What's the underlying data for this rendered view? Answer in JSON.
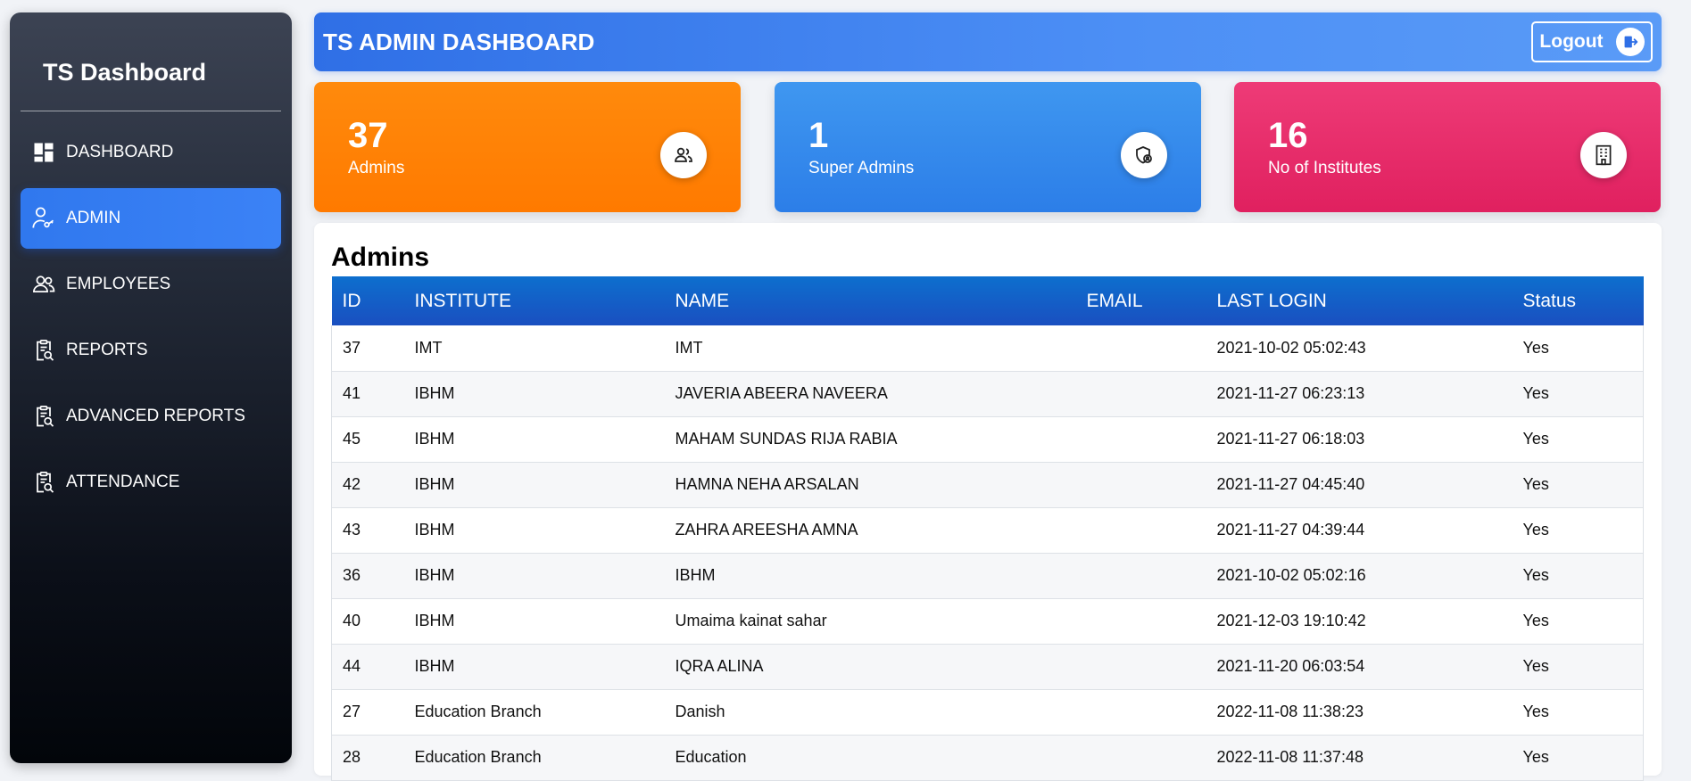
{
  "sidebar": {
    "brand": "TS Dashboard",
    "items": [
      {
        "label": "DASHBOARD",
        "icon": "dashboard-grid-icon",
        "active": false
      },
      {
        "label": "ADMIN",
        "icon": "user-key-icon",
        "active": true
      },
      {
        "label": "EMPLOYEES",
        "icon": "users-icon",
        "active": false
      },
      {
        "label": "REPORTS",
        "icon": "clipboard-search-icon",
        "active": false
      },
      {
        "label": "ADVANCED REPORTS",
        "icon": "clipboard-search-icon",
        "active": false
      },
      {
        "label": "ATTENDANCE",
        "icon": "clipboard-search-icon",
        "active": false
      }
    ]
  },
  "header": {
    "title": "TS ADMIN DASHBOARD",
    "logout_label": "Logout",
    "logout_icon": "logout-icon"
  },
  "cards": [
    {
      "value": "37",
      "label": "Admins",
      "icon": "users-icon",
      "color": "#ff7f00"
    },
    {
      "value": "1",
      "label": "Super Admins",
      "icon": "shield-user-icon",
      "color": "#2f85ec"
    },
    {
      "value": "16",
      "label": "No of Institutes",
      "icon": "building-icon",
      "color": "#e62a67"
    }
  ],
  "table": {
    "title": "Admins",
    "columns": [
      "ID",
      "INSTITUTE",
      "NAME",
      "EMAIL",
      "LAST LOGIN",
      "Status"
    ],
    "rows": [
      [
        "37",
        "IMT",
        "IMT",
        "",
        "2021-10-02 05:02:43",
        "Yes"
      ],
      [
        "41",
        "IBHM",
        "JAVERIA ABEERA NAVEERA",
        "",
        "2021-11-27 06:23:13",
        "Yes"
      ],
      [
        "45",
        "IBHM",
        "MAHAM SUNDAS RIJA RABIA",
        "",
        "2021-11-27 06:18:03",
        "Yes"
      ],
      [
        "42",
        "IBHM",
        "HAMNA NEHA ARSALAN",
        "",
        "2021-11-27 04:45:40",
        "Yes"
      ],
      [
        "43",
        "IBHM",
        "ZAHRA AREESHA AMNA",
        "",
        "2021-11-27 04:39:44",
        "Yes"
      ],
      [
        "36",
        "IBHM",
        "IBHM",
        "",
        "2021-10-02 05:02:16",
        "Yes"
      ],
      [
        "40",
        "IBHM",
        "Umaima kainat sahar",
        "",
        "2021-12-03 19:10:42",
        "Yes"
      ],
      [
        "44",
        "IBHM",
        "IQRA ALINA",
        "",
        "2021-11-20 06:03:54",
        "Yes"
      ],
      [
        "27",
        "Education Branch",
        "Danish",
        "",
        "2022-11-08 11:38:23",
        "Yes"
      ],
      [
        "28",
        "Education Branch",
        "Education",
        "",
        "2022-11-08 11:37:48",
        "Yes"
      ]
    ]
  }
}
